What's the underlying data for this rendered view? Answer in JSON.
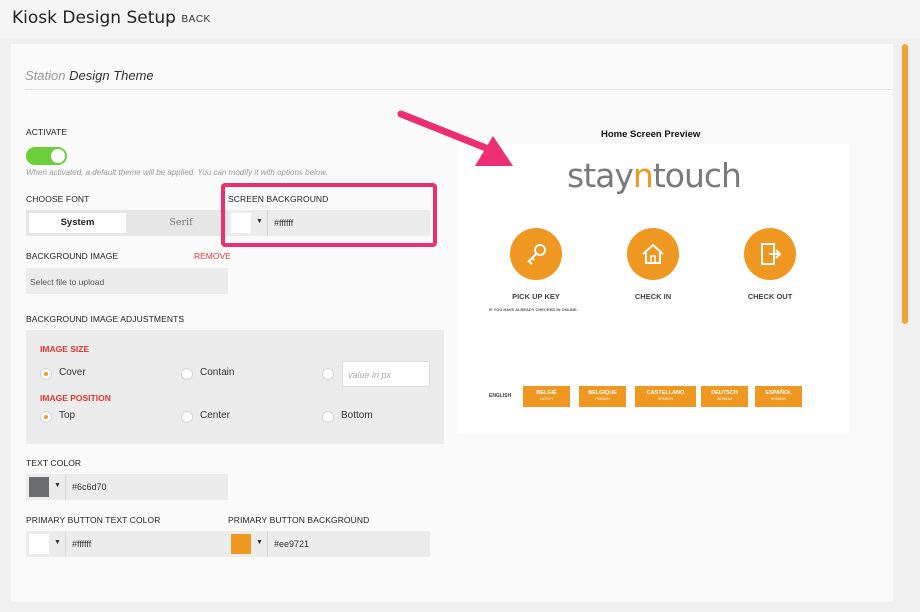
{
  "header": {
    "title": "Kiosk Design Setup",
    "back_label": "BACK"
  },
  "section": {
    "title_muted": "Station",
    "title_rest": "Design Theme"
  },
  "activate": {
    "label": "ACTIVATE",
    "on": true,
    "hint": "When activated, a default theme will be applied. You can modify it with options below."
  },
  "font": {
    "label": "CHOOSE FONT",
    "options": [
      "System",
      "Serif"
    ],
    "selected": "System"
  },
  "screen_background": {
    "label": "SCREEN BACKGROUND",
    "value": "#ffffff"
  },
  "background_image": {
    "label": "BACKGROUND IMAGE",
    "remove_label": "REMOVE",
    "placeholder": "Select file to upload"
  },
  "adjustments": {
    "label": "BACKGROUND IMAGE ADJUSTMENTS",
    "image_size": {
      "label": "IMAGE SIZE",
      "options": [
        "Cover",
        "Contain"
      ],
      "selected": "Cover",
      "custom_placeholder": "value in px"
    },
    "image_position": {
      "label": "IMAGE POSITION",
      "options": [
        "Top",
        "Center",
        "Bottom"
      ],
      "selected": "Top"
    }
  },
  "text_color": {
    "label": "TEXT COLOR",
    "value": "#6c6d70"
  },
  "primary_button_text_color": {
    "label": "PRIMARY BUTTON TEXT COLOR",
    "value": "#ffffff"
  },
  "primary_button_background": {
    "label": "PRIMARY BUTTON BACKGROUND",
    "value": "#ee9721"
  },
  "preview": {
    "title": "Home Screen Preview",
    "logo_a": "stay",
    "logo_n": "n",
    "logo_b": "touch",
    "actions": [
      {
        "label": "PICK UP KEY",
        "icon": "key-icon"
      },
      {
        "label": "CHECK IN",
        "icon": "home-icon"
      },
      {
        "label": "CHECK OUT",
        "icon": "exit-door-icon"
      }
    ],
    "pickup_sub": "IF YOU HAVE ALREADY CHECKED IN ONLINE.",
    "current_language": "ENGLISH",
    "languages": [
      {
        "name": "BELGIË",
        "sub": "DUTCH"
      },
      {
        "name": "BELGIQUE",
        "sub": "FRENCH"
      },
      {
        "name": "CASTELLANO",
        "sub": "SPANISH"
      },
      {
        "name": "DEUTSCH",
        "sub": "GERMAN"
      },
      {
        "name": "ESPAÑOL",
        "sub": "SPANISH"
      }
    ]
  },
  "colors": {
    "accent": "#ee9721",
    "toggle_on": "#6ccf3b",
    "highlight": "#ec2f73",
    "remove": "#e23b3b"
  }
}
